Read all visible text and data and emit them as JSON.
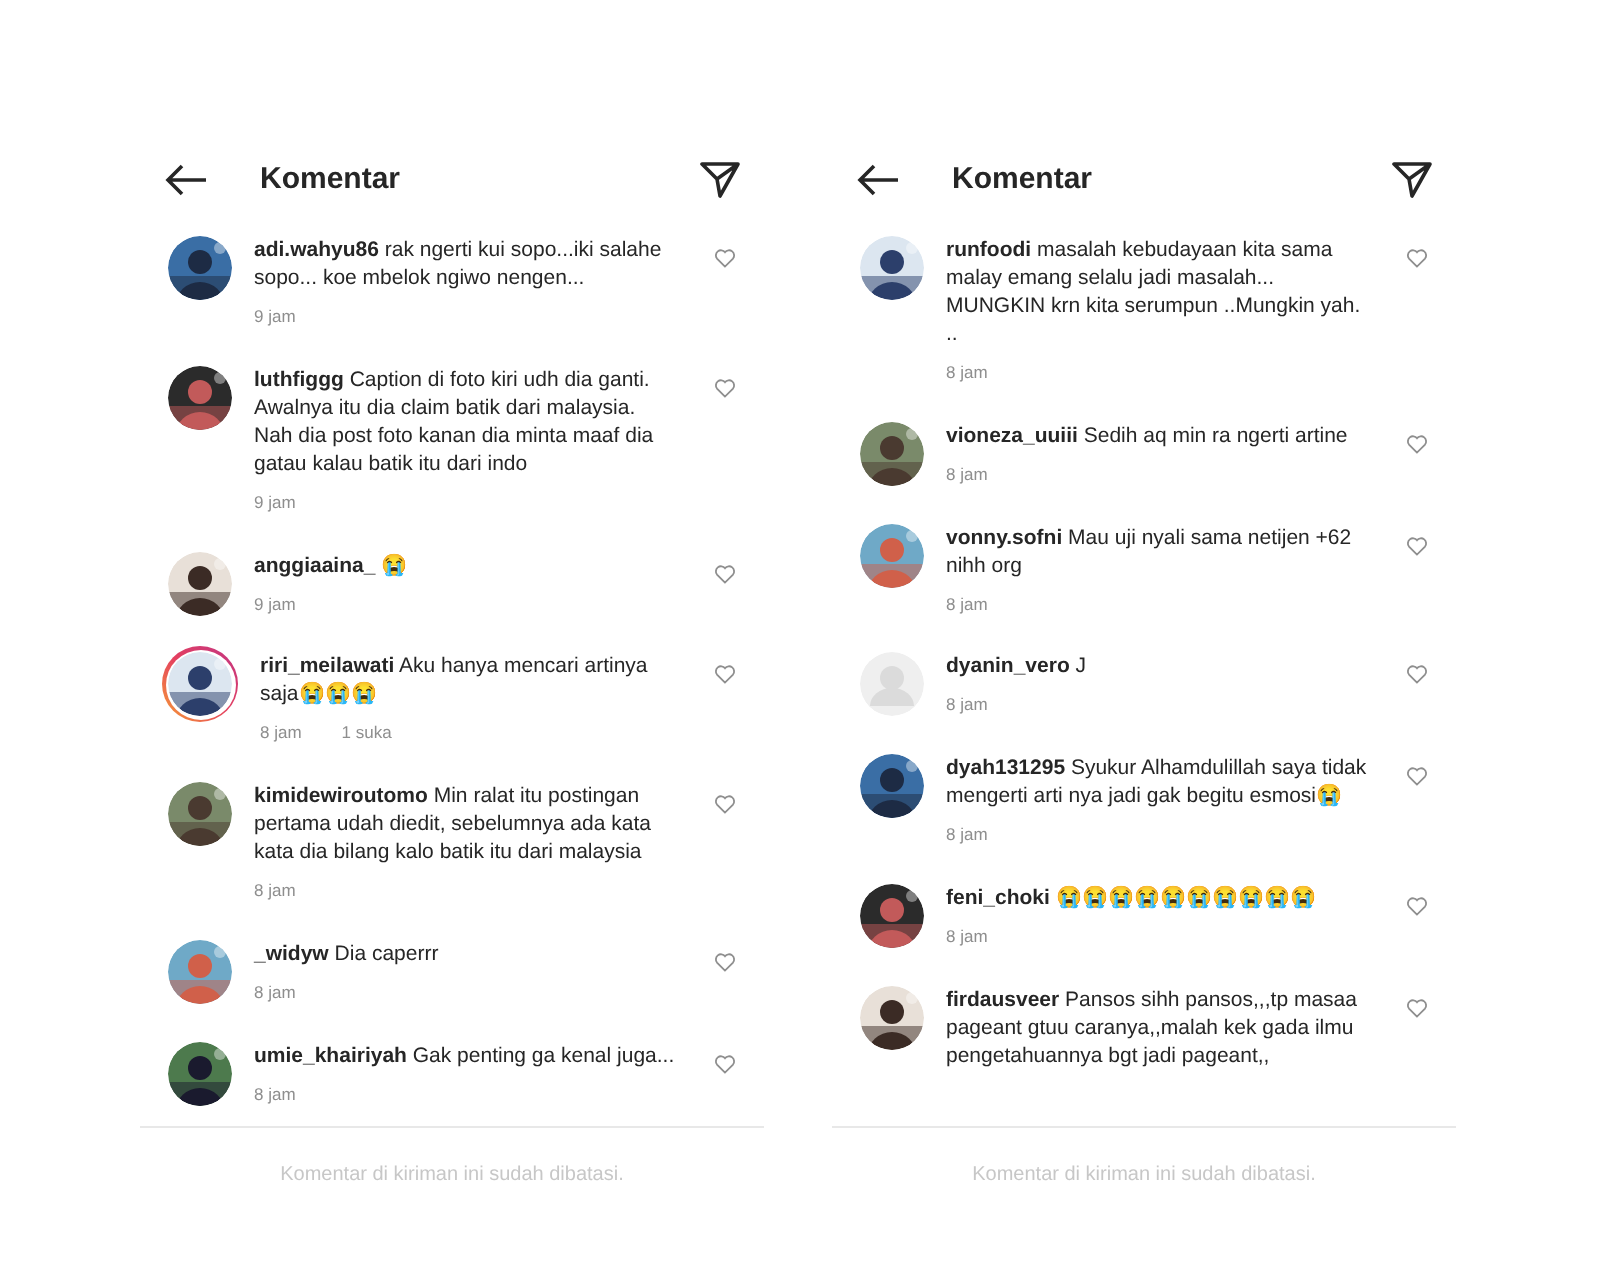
{
  "panels": [
    {
      "header": {
        "title": "Komentar"
      },
      "comments": [
        {
          "username": "adi.wahyu86",
          "text": "rak ngerti kui sopo...iki salahe sopo... koe mbelok ngiwo nengen...",
          "time": "9 jam",
          "story_ring": false
        },
        {
          "username": "luthfiggg",
          "text": "Caption di foto kiri udh dia ganti. Awalnya itu dia claim batik dari malaysia. Nah dia post foto kanan dia minta maaf dia gatau kalau batik itu dari indo",
          "time": "9 jam",
          "story_ring": false
        },
        {
          "username": "anggiaaina_",
          "text": "😭",
          "time": "9 jam",
          "story_ring": false
        },
        {
          "username": "riri_meilawati",
          "text": "Aku hanya mencari artinya saja😭😭😭",
          "time": "8 jam",
          "likes": "1 suka",
          "story_ring": true
        },
        {
          "username": "kimidewiroutomo",
          "text": "Min ralat itu postingan pertama udah diedit, sebelumnya ada kata kata dia bilang kalo batik itu dari malaysia",
          "time": "8 jam",
          "story_ring": false
        },
        {
          "username": "_widyw",
          "text": "Dia caperrr",
          "time": "8 jam",
          "story_ring": false
        },
        {
          "username": "umie_khairiyah",
          "text": "Gak penting ga kenal juga...",
          "time": "8 jam",
          "story_ring": false
        }
      ],
      "footer": "Komentar di kiriman ini sudah dibatasi."
    },
    {
      "header": {
        "title": "Komentar"
      },
      "comments": [
        {
          "username": "runfoodi",
          "text": "masalah kebudayaan kita sama malay emang selalu jadi masalah... MUNGKIN krn kita serumpun ..Mungkin yah. ..",
          "time": "8 jam",
          "story_ring": false
        },
        {
          "username": "vioneza_uuiii",
          "text": "Sedih aq min ra ngerti artine",
          "time": "8 jam",
          "story_ring": false
        },
        {
          "username": "vonny.sofni",
          "text": "Mau uji nyali sama netijen +62 nihh org",
          "time": "8 jam",
          "story_ring": false
        },
        {
          "username": "dyanin_vero",
          "text": "J",
          "time": "8 jam",
          "kind": "default",
          "story_ring": false
        },
        {
          "username": "dyah131295",
          "text": "Syukur Alhamdulillah saya tidak mengerti arti nya jadi gak begitu esmosi😭",
          "time": "8 jam",
          "story_ring": false
        },
        {
          "username": "feni_choki",
          "text": "😭😭😭😭😭😭😭😭😭😭",
          "time": "8 jam",
          "story_ring": false
        },
        {
          "username": "firdausveer",
          "text": "Pansos sihh pansos,,,tp masaa pageant gtuu caranya,,malah kek gada ilmu pengetahuannya bgt jadi pageant,,",
          "story_ring": false
        }
      ],
      "footer": "Komentar di kiriman ini sudah dibatasi."
    }
  ]
}
